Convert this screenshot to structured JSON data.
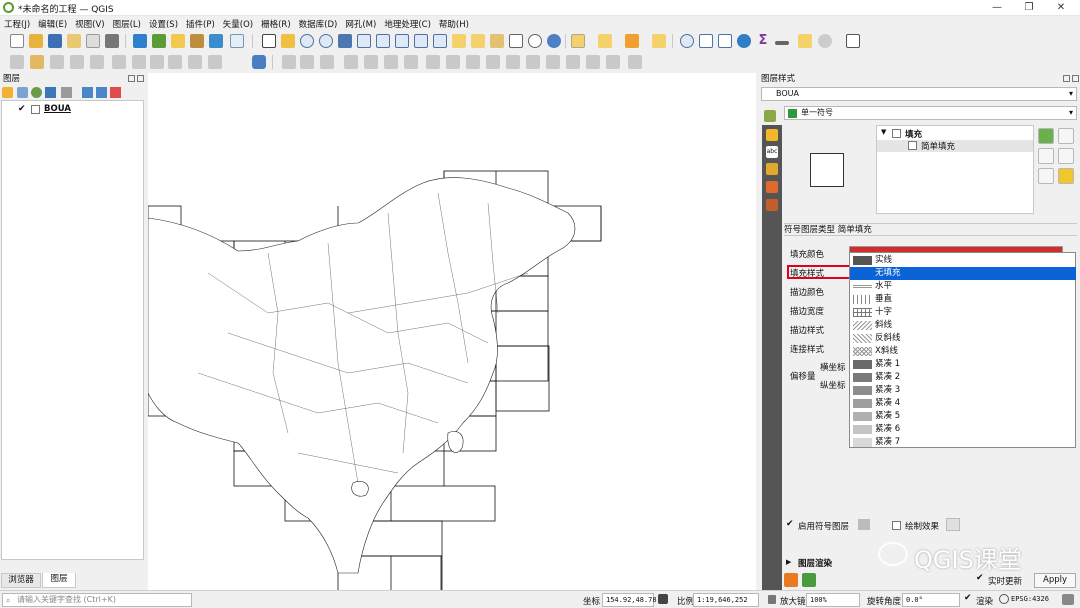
{
  "window": {
    "title": "*未命名的工程 — QGIS",
    "min": "—",
    "max": "❐",
    "close": "✕"
  },
  "menu": [
    "工程(J)",
    "编辑(E)",
    "视图(V)",
    "图层(L)",
    "设置(S)",
    "插件(P)",
    "矢量(O)",
    "栅格(R)",
    "数据库(D)",
    "网孔(M)",
    "地理处理(C)",
    "帮助(H)"
  ],
  "layers_panel": {
    "title": "图层",
    "layer_name": "BOUA",
    "tab_browser": "浏览器",
    "tab_layers": "图层"
  },
  "style_panel": {
    "title": "图层样式",
    "layer_select": "BOUA",
    "renderer": "单一符号",
    "tree_fill": "填充",
    "tree_simple_fill": "简单填充",
    "symbol_layer_type": "符号图层类型 简单填充",
    "fill_color_label": "填充颜色",
    "fill_style_label": "填充样式",
    "stroke_color_label": "描边颜色",
    "stroke_width_label": "描边宽度",
    "stroke_style_label": "描边样式",
    "join_style_label": "连接样式",
    "offset_label": "偏移量",
    "x_label": "横坐标",
    "y_label": "纵坐标",
    "enable_symbol_layer": "启用符号图层",
    "draw_effects": "绘制效果",
    "layer_rendering": "图层渲染",
    "live_update": "实时更新",
    "apply": "Apply"
  },
  "fill_style_options": [
    {
      "label": "实线",
      "swatch": "#555555"
    },
    {
      "label": "无填充",
      "swatch": "",
      "selected": true
    },
    {
      "label": "水平",
      "swatch": ""
    },
    {
      "label": "垂直",
      "swatch": ""
    },
    {
      "label": "十字",
      "swatch": ""
    },
    {
      "label": "斜线",
      "swatch": ""
    },
    {
      "label": "反斜线",
      "swatch": ""
    },
    {
      "label": "X斜线",
      "swatch": ""
    },
    {
      "label": "紧凑 1",
      "swatch": "#6a6a6a"
    },
    {
      "label": "紧凑 2",
      "swatch": "#7a7a7a"
    },
    {
      "label": "紧凑 3",
      "swatch": "#8d8d8d"
    },
    {
      "label": "紧凑 4",
      "swatch": "#9e9e9e"
    },
    {
      "label": "紧凑 5",
      "swatch": "#b0b0b0"
    },
    {
      "label": "紧凑 6",
      "swatch": "#c4c4c4"
    },
    {
      "label": "紧凑 7",
      "swatch": "#d8d8d8"
    }
  ],
  "status": {
    "search_placeholder": "请输入关键字查找 (Ctrl+K)",
    "coord_label": "坐标",
    "coord_value": "154.92,48.78",
    "scale_label": "比例",
    "scale_value": "1:19,646,252",
    "magnifier_label": "放大镜",
    "magnifier_value": "100%",
    "rotation_label": "旋转角度",
    "rotation_value": "0.0°",
    "render_label": "渲染",
    "crs": "EPSG:4326"
  },
  "watermark": "QGIS课堂",
  "colors": {
    "selection": "#0a64d8",
    "highlight_box": "#e0001a",
    "fill_color": "#d02d2d"
  }
}
